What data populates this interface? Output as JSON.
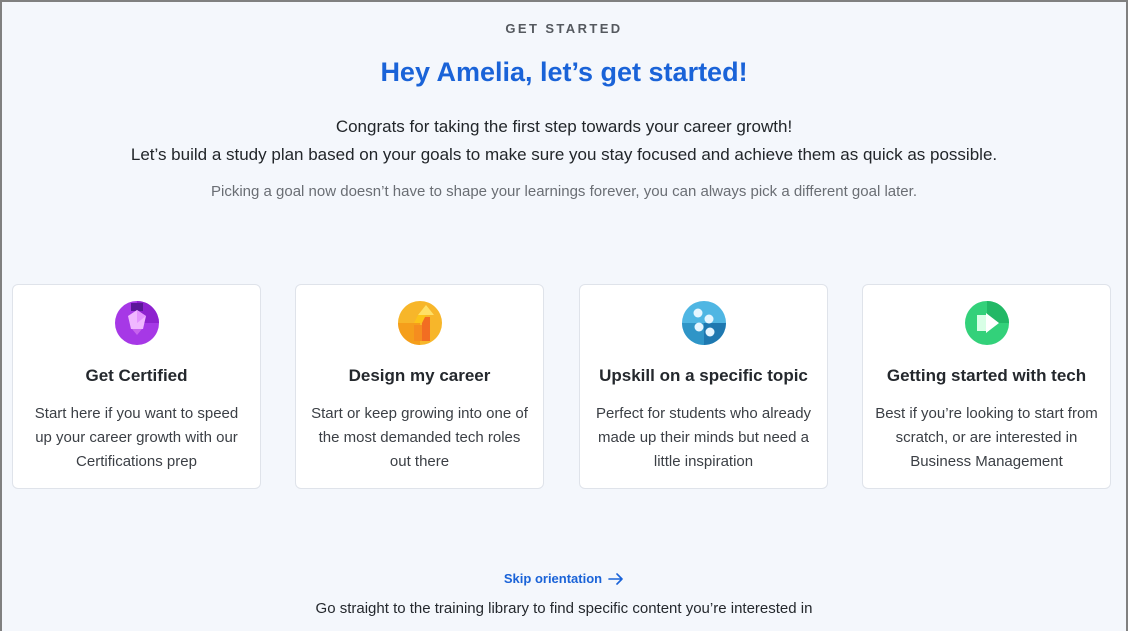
{
  "header": {
    "eyebrow": "GET STARTED",
    "title": "Hey Amelia, let’s get started!",
    "intro_line_1": "Congrats for taking the first step towards your career growth!",
    "intro_line_2": "Let’s build a study plan based on your goals to make sure you stay focused and achieve them as quick as possible.",
    "note": "Picking a goal now doesn’t have to shape your learnings forever, you can always pick a different goal later."
  },
  "goals": [
    {
      "icon": "certification-badge-icon",
      "title": "Get Certified",
      "description": "Start here if you want to speed up your career growth with our Certifications prep",
      "accent": "#a638e6"
    },
    {
      "icon": "career-arrow-icon",
      "title": "Design my career",
      "description": "Start or keep growing into one of the most demanded tech roles out there",
      "accent": "#f7a51c"
    },
    {
      "icon": "topic-dots-icon",
      "title": "Upskill on a specific topic",
      "description": "Perfect for students who already made up their minds but need a little inspiration",
      "accent": "#3aa7d9"
    },
    {
      "icon": "play-icon",
      "title": "Getting started with tech",
      "description": "Best if you’re looking to start from scratch, or are interested in Business Management",
      "accent": "#26c76a"
    }
  ],
  "skip": {
    "label": "Skip orientation",
    "icon": "arrow-right-icon",
    "description": "Go straight to the training library to find specific content you’re interested in"
  },
  "colors": {
    "brand_blue": "#1a63d8",
    "page_background": "#f4f7fc",
    "card_background": "#ffffff"
  }
}
